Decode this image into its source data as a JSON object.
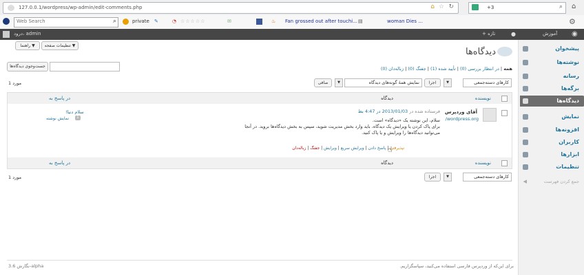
{
  "browser": {
    "url": "127.0.0.1/wordpress/wp-admin/edit-comments.php",
    "search_placeholder": "Web Search",
    "search_field_value": "+3",
    "toolbar_items": [
      "private",
      "Fan grossed out after touchi...",
      "woman Dies ..."
    ],
    "rating_stars": "☆☆☆☆☆"
  },
  "adminbar": {
    "site": "آموزش",
    "new": "+ تازه",
    "howdy": "درود، admin"
  },
  "sidebar": {
    "items": [
      "پیشخوان",
      "نوشته‌ها",
      "رسانه",
      "برگه‌ها",
      "دیدگاه‌ها",
      "نمایش",
      "افزونه‌ها",
      "کاربران",
      "ابزارها",
      "تنظیمات",
      "جمع کردن فهرست"
    ]
  },
  "main": {
    "screen_options": "تنظیمات صفحه ▼",
    "help": "راهنما ▼",
    "page_title": "دیدگاه‌ها",
    "filters": {
      "all": "همه",
      "pending": "در انتظار بررسی (0)",
      "approved": "تأیید شده (1)",
      "spam": "جفنگ (0)",
      "trash": "زباله‌دان (0)"
    },
    "search_button": "جست‌وجوی دیدگاه‌ها",
    "bulk_select": "کارهای دسته‌جمعی",
    "apply": "اجرا",
    "type_select": "نمایش همهٔ گونه‌های دیدگاه",
    "filter_button": "صافی",
    "items_count": "1 مورد",
    "columns": {
      "author": "نویسنده",
      "comment": "دیدگاه",
      "in_response": "در پاسخ به"
    },
    "comment": {
      "author": "آقای وردپرس",
      "author_url": "/wordpress.org",
      "submitted": "فرستاده شده در",
      "date_link": "2013/01/03 در 4:47 بظ",
      "text_line1": "سلام، این نوشته یک «دیدگاه» است.",
      "text_line2": "برای پاک کردن یا ویرایش یک دیدگاه، باید وارد بخش مدیریت شوید، سپس به بخش دیدگاه‌ها بروید. در آنجا می‌توانید دیدگاه‌ها را ویرایش و یا پاک کنید.",
      "actions": [
        "نپذیرفتن",
        "پاسخ دادن",
        "ویرایش سریع",
        "ویرایش",
        "جفنگ",
        "زباله‌دان"
      ],
      "post_title": "سلام دنیا!",
      "view_post": "نمایش نوشته",
      "bubble_count": "1"
    },
    "footer_left": "نگارش 3.6-alpha",
    "footer_right": "برای این‌که از وردپرس فارسی استفاده می‌کنید، سپاسگزاریم."
  },
  "colors": {
    "link": "#21759b",
    "adminbar": "#464646",
    "sidebar": "#f1f1f1",
    "spam": "#bc0b0b"
  }
}
